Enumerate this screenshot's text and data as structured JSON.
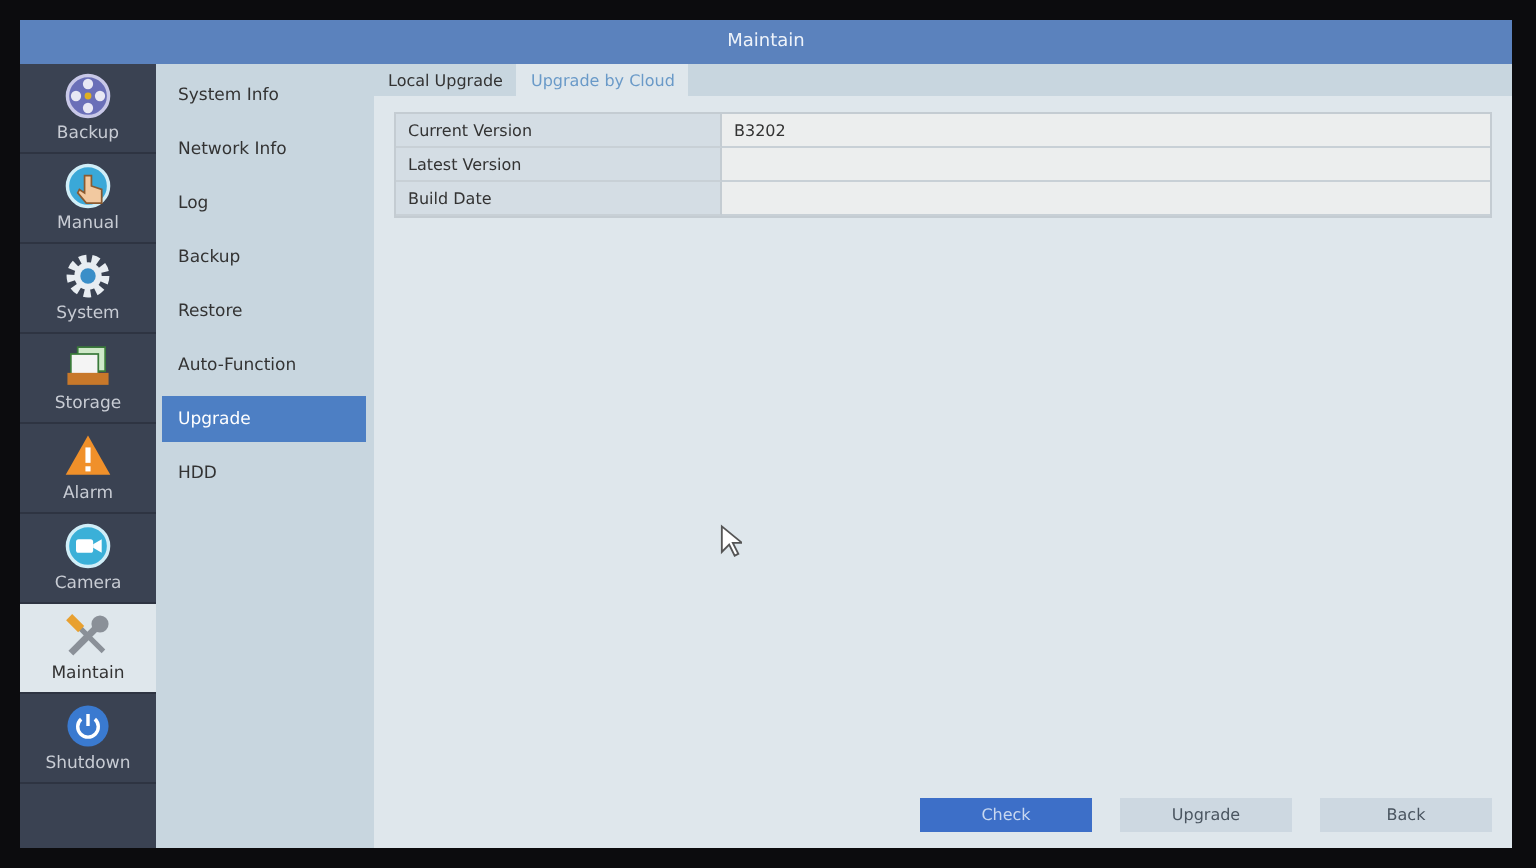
{
  "window": {
    "title": "Maintain"
  },
  "nav": [
    {
      "label": "Backup",
      "kind": "film",
      "selected": false
    },
    {
      "label": "Manual",
      "kind": "hand",
      "selected": false
    },
    {
      "label": "System",
      "kind": "gear",
      "selected": false
    },
    {
      "label": "Storage",
      "kind": "storage",
      "selected": false
    },
    {
      "label": "Alarm",
      "kind": "alarm",
      "selected": false
    },
    {
      "label": "Camera",
      "kind": "camera",
      "selected": false
    },
    {
      "label": "Maintain",
      "kind": "tools",
      "selected": true
    },
    {
      "label": "Shutdown",
      "kind": "power",
      "selected": false
    }
  ],
  "submenu": [
    {
      "label": "System Info",
      "selected": false
    },
    {
      "label": "Network Info",
      "selected": false
    },
    {
      "label": "Log",
      "selected": false
    },
    {
      "label": "Backup",
      "selected": false
    },
    {
      "label": "Restore",
      "selected": false
    },
    {
      "label": "Auto-Function",
      "selected": false
    },
    {
      "label": "Upgrade",
      "selected": true
    },
    {
      "label": "HDD",
      "selected": false
    }
  ],
  "tabs": [
    {
      "label": "Local Upgrade",
      "selected": false
    },
    {
      "label": "Upgrade by Cloud",
      "selected": true
    }
  ],
  "info_table": [
    {
      "label": "Current Version",
      "value": "B3202"
    },
    {
      "label": "Latest Version"
    },
    {
      "label": "Build Date"
    }
  ],
  "buttons": [
    {
      "label": "Check",
      "kind": "primary"
    },
    {
      "label": "Upgrade",
      "kind": "normal"
    },
    {
      "label": "Back",
      "kind": "normal"
    }
  ]
}
